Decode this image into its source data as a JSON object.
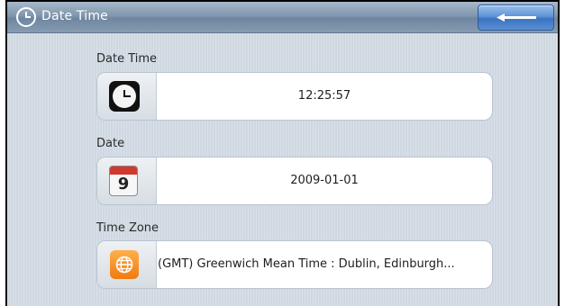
{
  "header": {
    "title": "Date Time",
    "title_icon": "clock-icon",
    "back_icon": "back-arrow-icon"
  },
  "settings": [
    {
      "label": "Date Time",
      "value": "12:25:57",
      "icon": "clock-icon"
    },
    {
      "label": "Date",
      "value": "2009-01-01",
      "icon": "calendar-icon",
      "icon_text": "9"
    },
    {
      "label": "Time Zone",
      "value": "(GMT) Greenwich Mean Time : Dublin, Edinburgh...",
      "icon": "globe-icon"
    }
  ],
  "colors": {
    "titlebar": "#8197ae",
    "back_button": "#4a82cc",
    "background": "#cfd8e1",
    "calendar_header": "#d03a2e",
    "globe_tile": "#f08a1c"
  }
}
